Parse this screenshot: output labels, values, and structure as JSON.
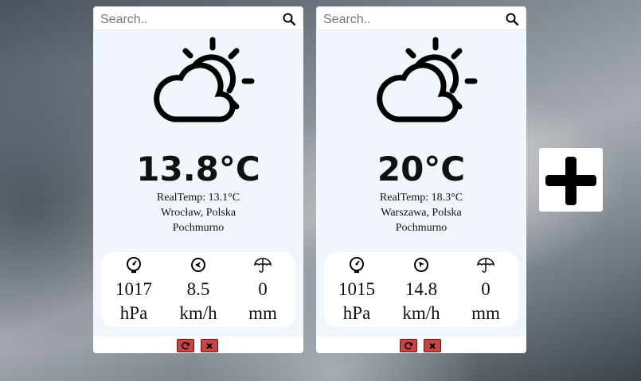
{
  "add_card": {
    "icon": "plus-icon"
  },
  "cards": [
    {
      "search": {
        "placeholder": "Search..",
        "icon": "search-icon"
      },
      "weather_icon": "partly-cloudy-icon",
      "temperature": "13.8°C",
      "real_temp": "RealTemp: 13.1°C",
      "location": "Wrocław, Polska",
      "description": "Pochmurno",
      "stats": [
        {
          "icon": "pressure-gauge-icon",
          "value": "1017",
          "unit": "hPa"
        },
        {
          "icon": "wind-compass-icon",
          "value": "8.5",
          "unit": "km/h"
        },
        {
          "icon": "umbrella-icon",
          "value": "0",
          "unit": "mm"
        }
      ],
      "buttons": {
        "refresh_icon": "refresh-icon",
        "close_icon": "close-icon"
      },
      "accent_color": "#c84545"
    },
    {
      "search": {
        "placeholder": "Search..",
        "icon": "search-icon"
      },
      "weather_icon": "partly-cloudy-icon",
      "temperature": "20°C",
      "real_temp": "RealTemp: 18.3°C",
      "location": "Warszawa, Polska",
      "description": "Pochmurno",
      "stats": [
        {
          "icon": "pressure-gauge-icon",
          "value": "1015",
          "unit": "hPa"
        },
        {
          "icon": "wind-compass-icon",
          "value": "14.8",
          "unit": "km/h"
        },
        {
          "icon": "umbrella-icon",
          "value": "0",
          "unit": "mm"
        }
      ],
      "buttons": {
        "refresh_icon": "refresh-icon",
        "close_icon": "close-icon"
      },
      "accent_color": "#c84545"
    }
  ]
}
